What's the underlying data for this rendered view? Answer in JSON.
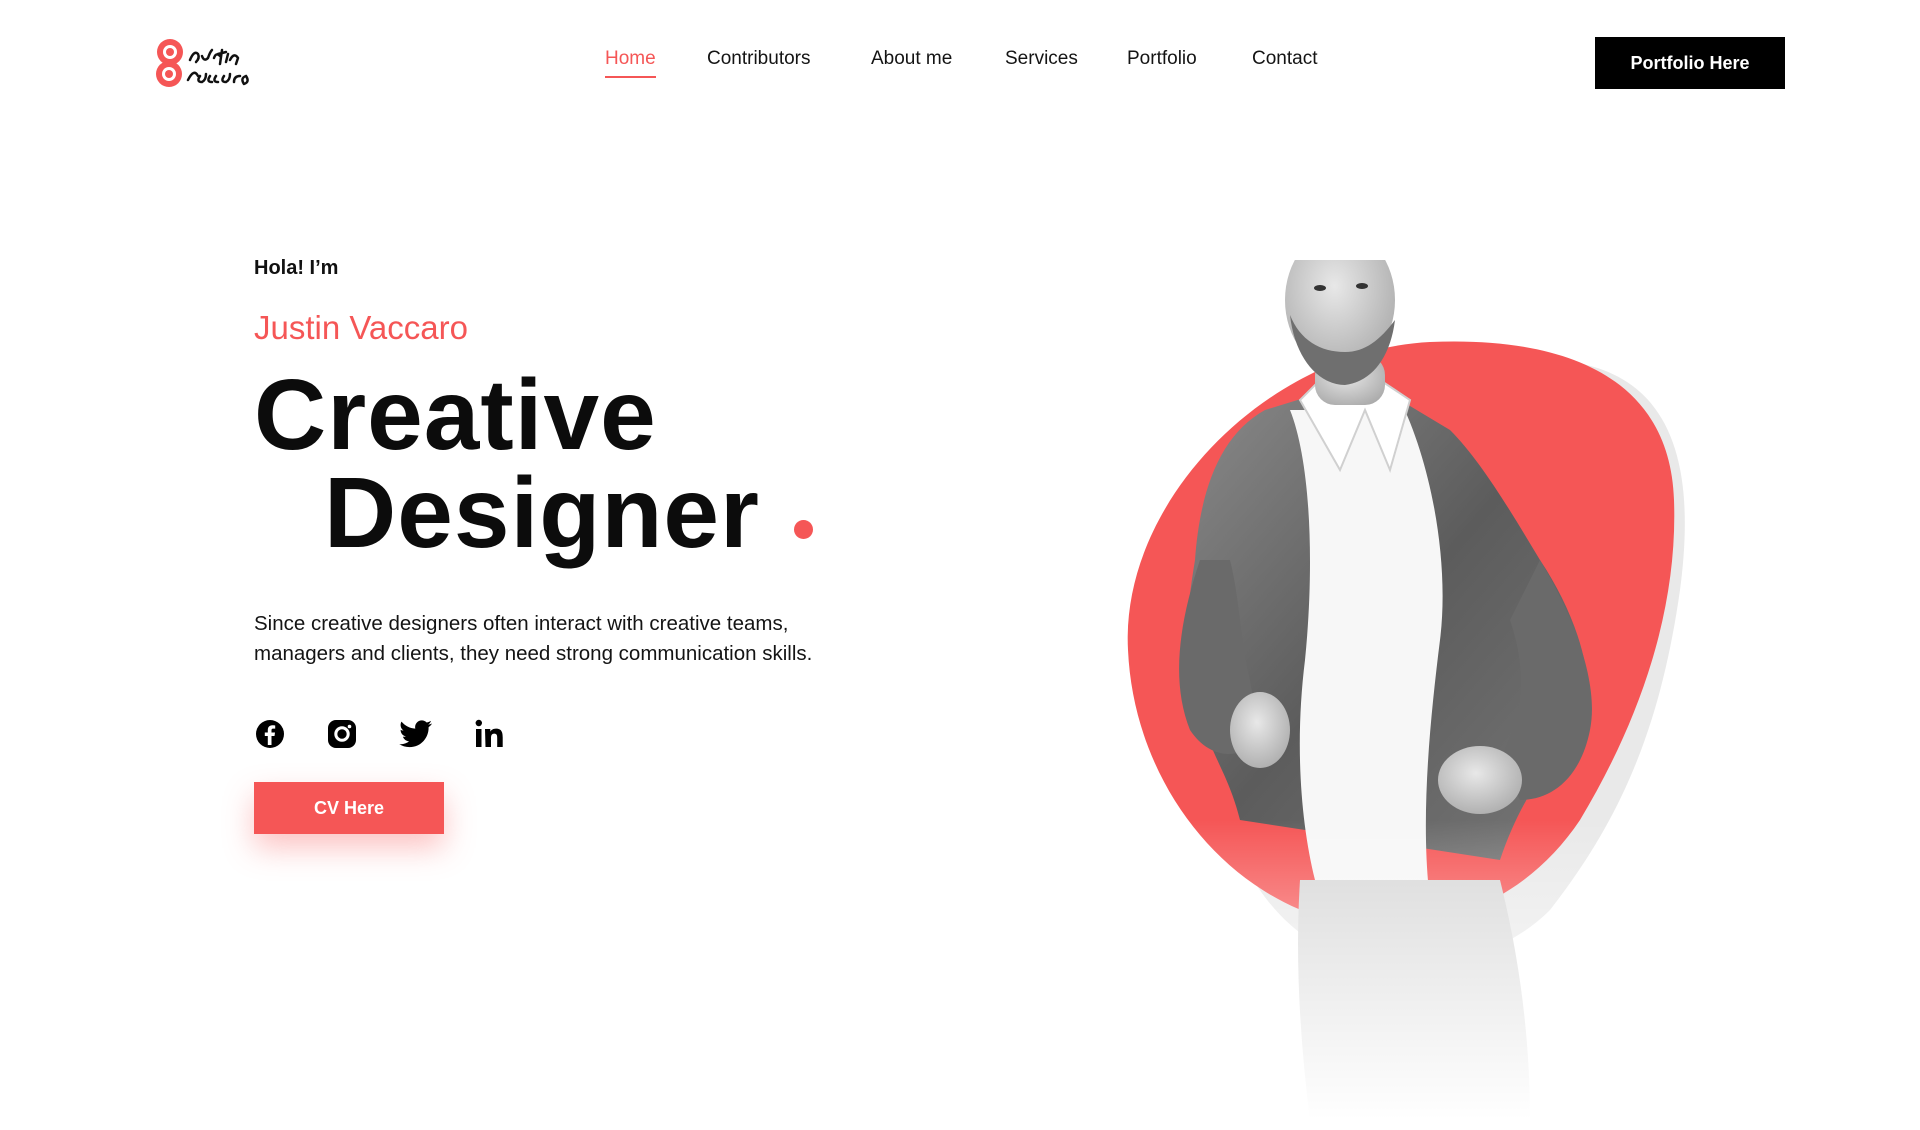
{
  "brand": {
    "logo_text": "Justin Vaccaro",
    "accent": "#f55656"
  },
  "nav": {
    "items": [
      {
        "label": "Home",
        "active": true
      },
      {
        "label": "Contributors",
        "active": false
      },
      {
        "label": "About me",
        "active": false
      },
      {
        "label": "Services",
        "active": false
      },
      {
        "label": "Portfolio",
        "active": false
      },
      {
        "label": "Contact",
        "active": false
      }
    ],
    "cta_label": "Portfolio Here"
  },
  "hero": {
    "greeting": "Hola! I’m",
    "name": "Justin Vaccaro",
    "title_line1": "Creative",
    "title_line2": "Designer",
    "description": "Since creative designers often interact with creative teams, managers and clients, they need strong communication skills.",
    "socials": [
      "facebook-icon",
      "instagram-icon",
      "twitter-icon",
      "linkedin-icon"
    ],
    "cv_label": "CV Here"
  }
}
